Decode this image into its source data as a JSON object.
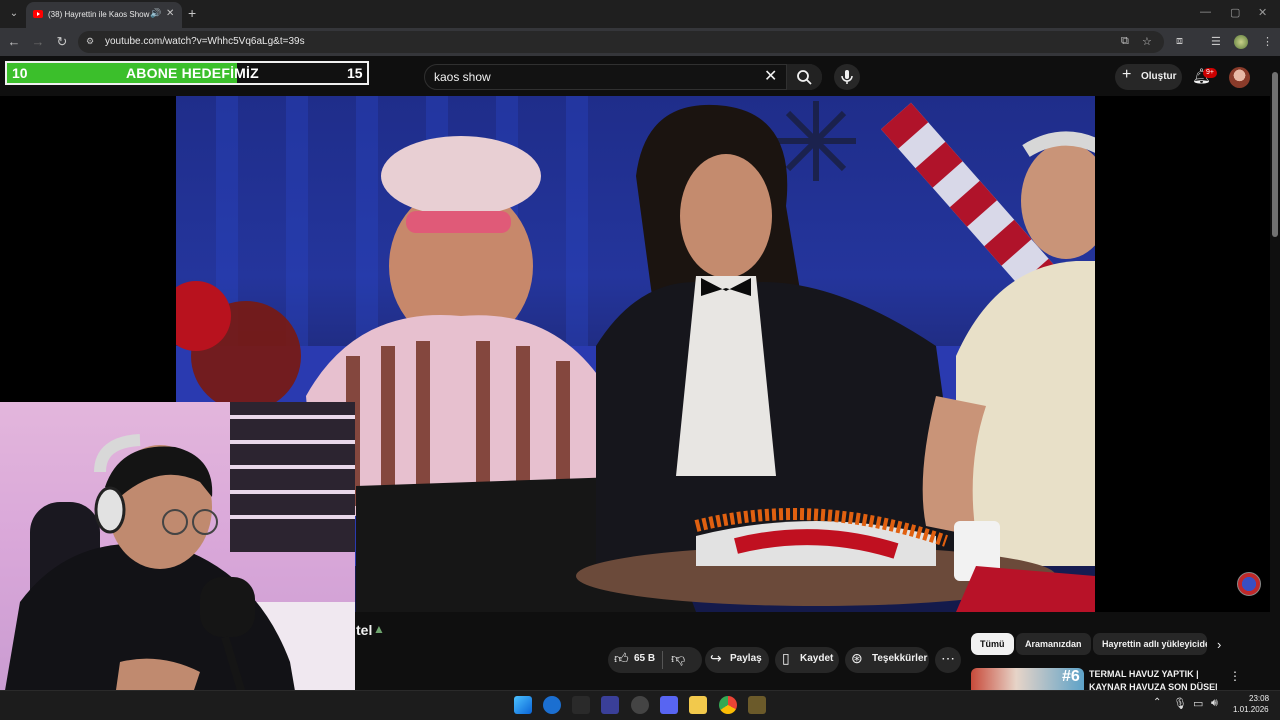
{
  "browser": {
    "tab_title": "(38) Hayrettin ile Kaos Show",
    "url": "youtube.com/watch?v=Whhc5Vq6aLg&t=39s"
  },
  "overlay_goal": {
    "current": "10",
    "title": "ABONE HEDEFİMİZ",
    "target": "15",
    "progress_fraction": 0.64
  },
  "header": {
    "search_value": "kaos show",
    "create_label": "Oluştur",
    "notifications_badge": "9+"
  },
  "video": {
    "title_fragment": "tel"
  },
  "actions": {
    "like_count": "65 B",
    "share_label": "Paylaş",
    "save_label": "Kaydet",
    "thanks_label": "Teşekkürler"
  },
  "chips": [
    "Tümü",
    "Aramanızdan",
    "Hayrettin adlı yükleyiciden"
  ],
  "recommended": {
    "number": "#6",
    "title_line1": "TERMAL HAVUZ YAPTIK |",
    "title_line2": "KAYNAR HAVUZA SON DÜŞEN"
  },
  "taskbar": {
    "time": "23:08",
    "date": "1.01.2026"
  },
  "colors": {
    "goal_fill": "#3bbf2b",
    "youtube_red": "#ff0000",
    "background": "#0f0f0f"
  }
}
